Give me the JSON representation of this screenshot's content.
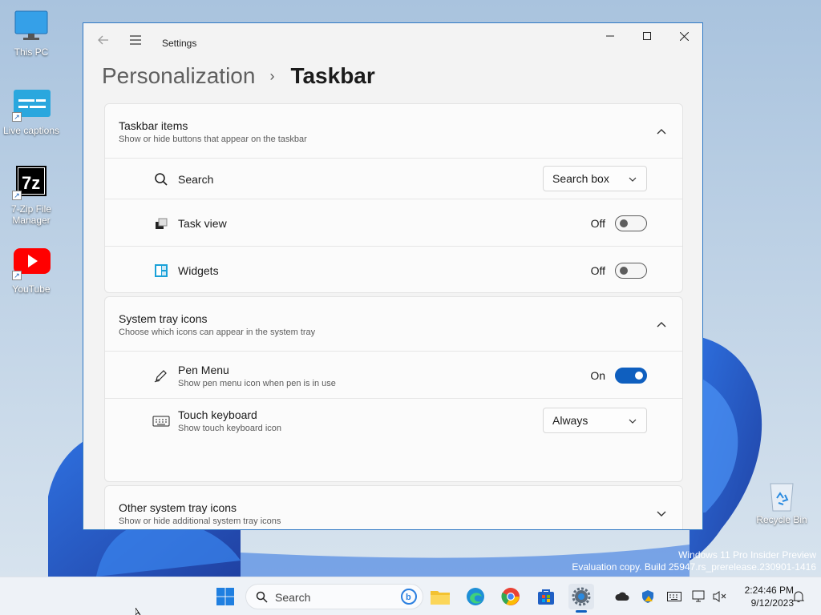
{
  "desktop": {
    "icons": [
      {
        "label": "This PC"
      },
      {
        "label": "Live captions"
      },
      {
        "label": "7-Zip File Manager"
      },
      {
        "label": "YouTube"
      }
    ],
    "recycle_bin": "Recycle Bin",
    "watermark": {
      "line1": "Windows 11 Pro Insider Preview",
      "line2": "Evaluation copy. Build 25947.rs_prerelease.230901-1416"
    }
  },
  "window": {
    "app_title": "Settings",
    "breadcrumb": {
      "parent": "Personalization",
      "separator": "›",
      "current": "Taskbar"
    },
    "sections": {
      "taskbar_items": {
        "title": "Taskbar items",
        "subtitle": "Show or hide buttons that appear on the taskbar",
        "search": {
          "label": "Search",
          "value": "Search box"
        },
        "task_view": {
          "label": "Task view",
          "state": "Off"
        },
        "widgets": {
          "label": "Widgets",
          "state": "Off"
        }
      },
      "system_tray": {
        "title": "System tray icons",
        "subtitle": "Choose which icons can appear in the system tray",
        "pen_menu": {
          "label": "Pen Menu",
          "sub": "Show pen menu icon when pen is in use",
          "state": "On"
        },
        "touch_keyboard": {
          "label": "Touch keyboard",
          "sub": "Show touch keyboard icon",
          "value": "Always"
        }
      },
      "other_tray": {
        "title": "Other system tray icons",
        "subtitle": "Show or hide additional system tray icons"
      }
    }
  },
  "taskbar": {
    "search_placeholder": "Search",
    "time": "2:24:46 PM",
    "date": "9/12/2023"
  },
  "colors": {
    "accent": "#0f5fbf",
    "window_border": "#2f78c4"
  }
}
